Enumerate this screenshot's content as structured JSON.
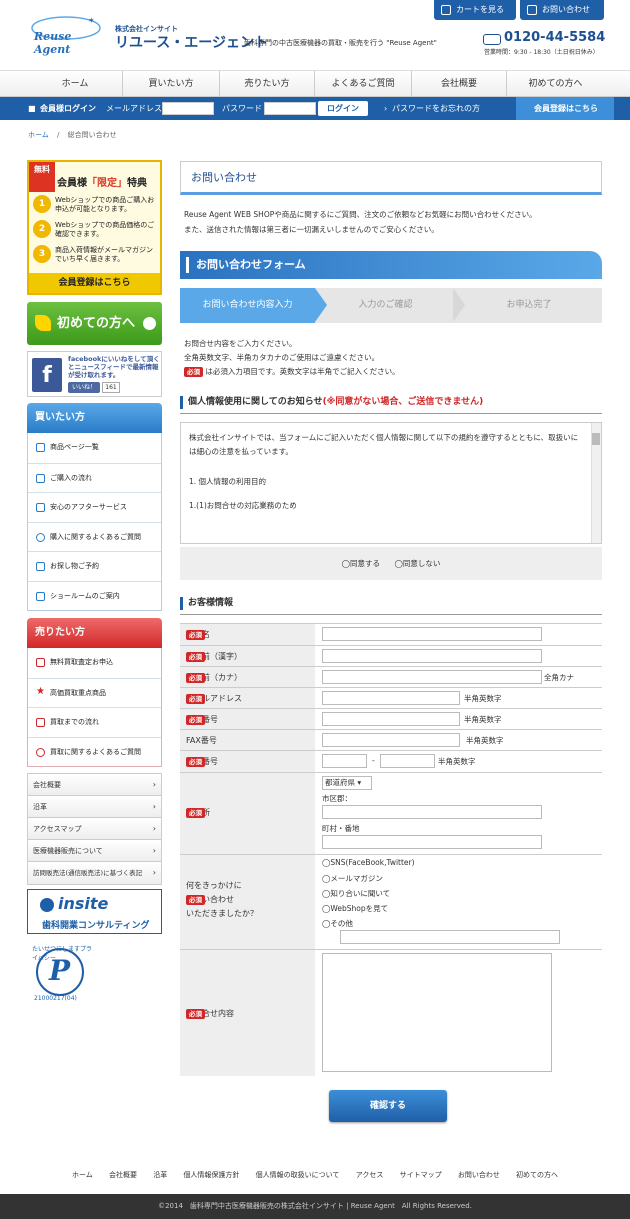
{
  "header": {
    "logo_text": "Reuse Agent",
    "company_small": "株式会社インサイト",
    "company_big": "リユース・エージェント",
    "tagline": "歯科専門の中古医療機器の買取・販売を行う \"Reuse Agent\"",
    "cart_label": "カートを見る",
    "contact_label": "お問い合わせ",
    "phone": "0120-44-5584",
    "hours": "営業時間：9:30 - 18:30（土日祝日休み）"
  },
  "nav": [
    "ホーム",
    "買いたい方",
    "売りたい方",
    "よくあるご質問",
    "会社概要",
    "初めての方へ"
  ],
  "loginbar": {
    "member_login": "会員様ログイン",
    "email_label": "メールアドレス",
    "password_label": "パスワード",
    "login_button": "ログイン",
    "forgot": "パスワードをお忘れの方",
    "register": "会員登録はこちら"
  },
  "breadcrumb": {
    "home": "ホーム",
    "sep": "/",
    "current": "総合問い合わせ"
  },
  "sidebar": {
    "banner_limited": {
      "muryo": "無料",
      "title_pre": "会員様",
      "title_key": "「限定」",
      "title_post": "特典",
      "items": [
        {
          "num": "1",
          "text": "Webショップでの商品ご購入お申込が可能となります。"
        },
        {
          "num": "2",
          "text": "Webショップでの商品価格のご確認できます。"
        },
        {
          "num": "3",
          "text": "商品入荷情報がメールマガジンでいち早く届きます。"
        }
      ],
      "footer": "会員登録はこちら"
    },
    "banner_first": "初めての方へ",
    "facebook": {
      "text": "facebookにいいねをして頂くとニュースフィードで最新情報が受け取れます。",
      "like": "いいね！",
      "count": "161"
    },
    "buy_head": "買いたい方",
    "buy_items": [
      "商品ページ一覧",
      "ご購入の流れ",
      "安心のアフターサービス",
      "購入に関するよくあるご質問",
      "お探し物ご予約",
      "ショールームのご案内"
    ],
    "sell_head": "売りたい方",
    "sell_items": [
      "無料買取査定お申込",
      "高価買取重点商品",
      "買取までの流れ",
      "買取に関するよくあるご質問"
    ],
    "info_items": [
      "会社概要",
      "沿革",
      "アクセスマップ",
      "医療機器販売について",
      "訪問販売法(通信販売法)に基づく表記"
    ],
    "insite_logo": "insite",
    "insite_sub": "歯科開業コンサルティング",
    "privacy_arc": "たいせつにしますプライバシー",
    "privacy_num": "21000217(04)"
  },
  "main": {
    "page_title": "お問い合わせ",
    "intro1": "Reuse Agent WEB SHOPや商品に関するにご質問、注文のご依頼などお気軽にお問い合わせください。",
    "intro2": "また、送信された情報は第三者に一切漏えいしませんのでご安心ください。",
    "form_title": "お問い合わせフォーム",
    "steps": [
      "お問い合わせ内容入力",
      "入力のご確認",
      "お申込完了"
    ],
    "note1": "お問合せ内容をご入力ください。",
    "note2": "全角英数文字、半角カタカナのご使用はご遠慮ください。",
    "req_label": "必須",
    "note3": "は必須入力項目です。英数文字は半角でご記入ください。",
    "privacy_head": "個人情報使用に関してのお知らせ",
    "privacy_warn": "(※同意がない場合、ご送信できません)",
    "privacy_text1": "株式会社インサイトでは、当フォームにご記入いただく個人情報に関して以下の規約を遵守するとともに、取扱いには細心の注意を払っています。",
    "privacy_text2": "1. 個人情報の利用目的",
    "privacy_text3": "1.(1)お問合せの対応業務のため",
    "agree": "同意する",
    "disagree": "同意しない",
    "customer_head": "お客様情報",
    "fields": {
      "clinic": "医院名",
      "name_kanji": "お名前（漢字）",
      "name_kana": "お名前（カナ）",
      "kana_suffix": "全角カナ",
      "email": "メールアドレス",
      "alnum_suffix": "半角英数字",
      "tel": "電話番号",
      "fax": "FAX番号",
      "zip": "郵便番号",
      "zip_sep": "-",
      "address": "ご住所",
      "pref": "都道府県",
      "city": "市区郡：",
      "town": "町村・番地",
      "how_label": [
        "何をきっかけに",
        "お問い合わせ",
        "いただきましたか？"
      ],
      "how_options": [
        "SNS(FaceBook,Twitter)",
        "メールマガジン",
        "知り合いに聞いて",
        "WebShopを見て",
        "その他"
      ],
      "content": "お問合せ内容"
    },
    "confirm_button": "確認する"
  },
  "footer": {
    "links": [
      "ホーム",
      "会社概要",
      "沿革",
      "個人情報保護方針",
      "個人情報の取扱いについて",
      "アクセス",
      "サイトマップ",
      "お問い合わせ",
      "初めての方へ"
    ],
    "copyright": "©2014　歯科専門中古医療機器販売の株式会社インサイト | Reuse Agent　All Rights Reserved."
  },
  "colors": {
    "brand_blue": "#1f5fa8",
    "light_blue": "#5aa8e8",
    "required_red": "#d02828",
    "green": "#4aa82a"
  }
}
